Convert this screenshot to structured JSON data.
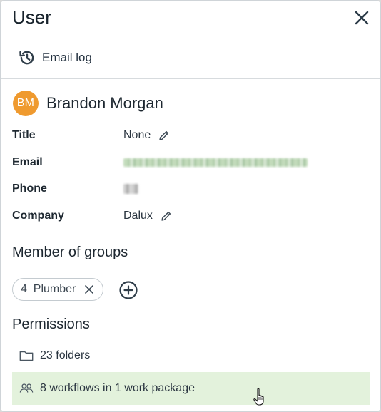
{
  "dialog": {
    "title": "User",
    "email_log_label": "Email log"
  },
  "user": {
    "initials": "BM",
    "name": "Brandon Morgan",
    "avatar_color": "#ef9a2f"
  },
  "details": {
    "title_label": "Title",
    "title_value": "None",
    "email_label": "Email",
    "phone_label": "Phone",
    "company_label": "Company",
    "company_value": "Dalux"
  },
  "groups": {
    "heading": "Member of groups",
    "items": [
      {
        "label": "4_Plumber"
      }
    ]
  },
  "permissions": {
    "heading": "Permissions",
    "folders_label": "23 folders",
    "workflows_label": "8 workflows in 1 work package",
    "hover_color": "#e3f2dc"
  },
  "icons": {
    "close": "close-icon",
    "history": "history-icon",
    "edit": "pencil-icon",
    "remove": "close-icon",
    "add": "plus-circle-icon",
    "folder": "folder-icon",
    "people": "people-icon",
    "cursor": "hand-pointer-icon"
  }
}
